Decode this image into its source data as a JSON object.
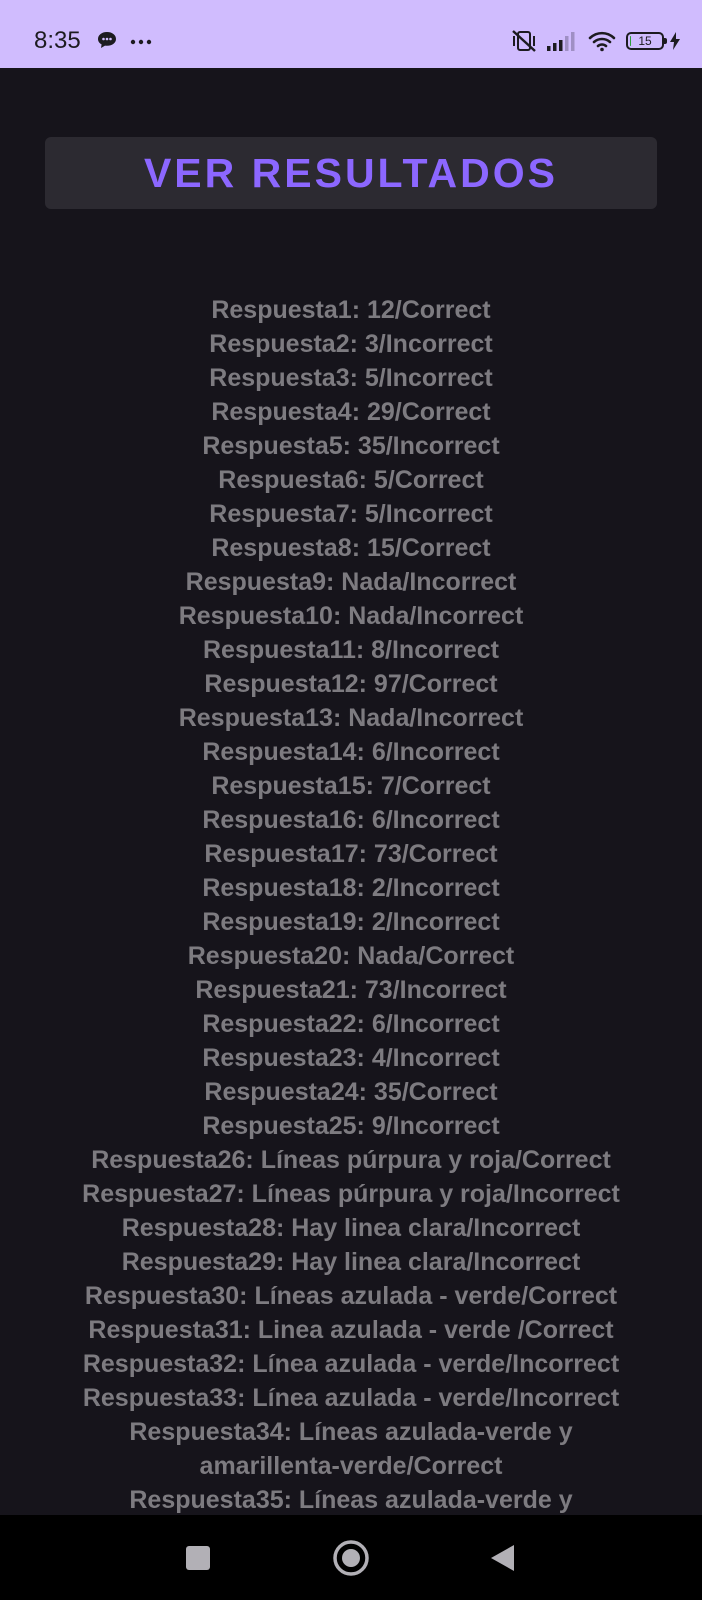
{
  "status_bar": {
    "time": "8:35",
    "battery_level": "15",
    "battery_fraction": 0.15,
    "left_icons": [
      "chat-bubble-icon",
      "more-dots-icon"
    ],
    "right_icons": [
      "vibrate-off-icon",
      "signal-icon",
      "wifi-icon",
      "battery-icon",
      "charging-bolt-icon"
    ]
  },
  "main": {
    "ver_resultados_label": "VER RESULTADOS",
    "results": [
      "Respuesta1: 12/Correct",
      "Respuesta2: 3/Incorrect",
      "Respuesta3: 5/Incorrect",
      "Respuesta4: 29/Correct",
      "Respuesta5: 35/Incorrect",
      "Respuesta6: 5/Correct",
      "Respuesta7: 5/Incorrect",
      "Respuesta8: 15/Correct",
      "Respuesta9: Nada/Incorrect",
      "Respuesta10: Nada/Incorrect",
      "Respuesta11: 8/Incorrect",
      "Respuesta12: 97/Correct",
      "Respuesta13: Nada/Incorrect",
      "Respuesta14: 6/Incorrect",
      "Respuesta15: 7/Correct",
      "Respuesta16: 6/Incorrect",
      "Respuesta17: 73/Correct",
      "Respuesta18: 2/Incorrect",
      "Respuesta19: 2/Incorrect",
      "Respuesta20: Nada/Correct",
      "Respuesta21: 73/Incorrect",
      "Respuesta22: 6/Incorrect",
      "Respuesta23: 4/Incorrect",
      "Respuesta24: 35/Correct",
      "Respuesta25: 9/Incorrect",
      "Respuesta26: Líneas púrpura y roja/Correct",
      "Respuesta27: Líneas púrpura y roja/Incorrect",
      "Respuesta28: Hay linea clara/Incorrect",
      "Respuesta29: Hay linea clara/Incorrect",
      "Respuesta30:  Líneas azulada - verde/Correct",
      "Respuesta31: Linea azulada - verde /Correct",
      "Respuesta32: Línea azulada - verde/Incorrect",
      "Respuesta33: Línea azulada - verde/Incorrect",
      "Respuesta34: Líneas azulada-verde y",
      "amarillenta-verde/Correct",
      "Respuesta35: Líneas azulada-verde y"
    ]
  },
  "nav_bar": {
    "buttons": [
      "recents-square-icon",
      "home-circle-icon",
      "back-triangle-icon"
    ]
  },
  "colors": {
    "status_bar_bg": "#d0bcfe",
    "background": "#16141b",
    "button_bg": "#2c2a31",
    "button_text": "#8c67ff",
    "result_text": "#7d7b80",
    "nav_bar_bg": "#000000"
  }
}
